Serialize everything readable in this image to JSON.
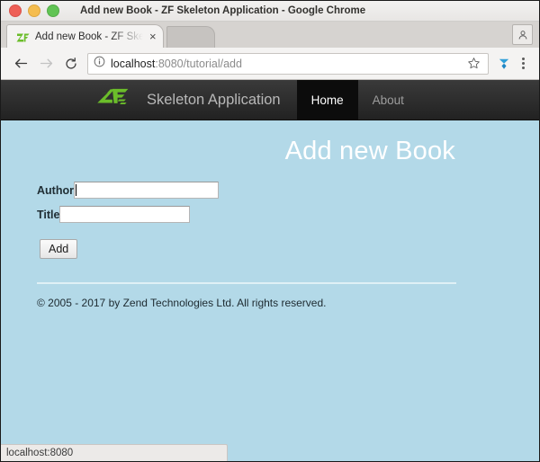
{
  "window": {
    "title": "Add new Book - ZF Skeleton Application - Google Chrome",
    "controls": {
      "close": "close-window",
      "minimize": "minimize-window",
      "maximize": "maximize-window"
    }
  },
  "tabs": [
    {
      "title": "Add new Book - ZF Skeleton Application",
      "favicon": "zf-logo-icon",
      "close_label": "×"
    }
  ],
  "toolbar": {
    "back_icon": "back-arrow-icon",
    "forward_icon": "forward-arrow-icon",
    "reload_icon": "reload-icon",
    "info_icon": "page-info-icon",
    "url_host": "localhost",
    "url_rest": ":8080/tutorial/add",
    "url_full": "localhost:8080/tutorial/add",
    "bookmark_icon": "star-icon",
    "extension_icon": "extension-icon",
    "menu_icon": "three-dot-menu-icon",
    "profile_icon": "profile-avatar-icon"
  },
  "site": {
    "brand_logo": "zf-logo",
    "brand_text": "Skeleton Application",
    "nav": [
      {
        "label": "Home",
        "active": true
      },
      {
        "label": "About",
        "active": false
      }
    ]
  },
  "main": {
    "page_title": "Add new Book",
    "form": {
      "fields": [
        {
          "label": "Author",
          "value": "",
          "focused": true
        },
        {
          "label": "Title",
          "value": "",
          "focused": false
        }
      ],
      "submit_label": "Add"
    },
    "footer_text": "© 2005 - 2017 by Zend Technologies Ltd. All rights reserved."
  },
  "status": {
    "text": "localhost:8080"
  },
  "colors": {
    "page_background": "#b3d9e8",
    "navbar_dark": "#2b2b2b",
    "navbar_active": "#0c0c0c",
    "brand_green": "#6bbd2a",
    "title_white": "#ffffff",
    "traffic_red": "#ee5f56",
    "traffic_yellow": "#f5bd4f",
    "traffic_green": "#61c454"
  }
}
